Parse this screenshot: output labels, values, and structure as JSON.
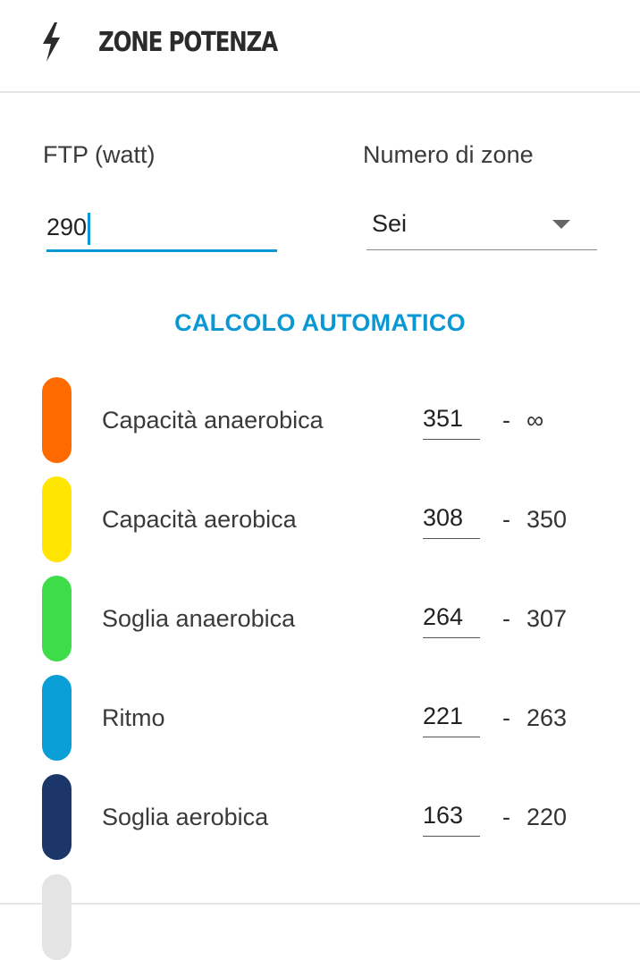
{
  "header": {
    "title": "ZONE POTENZA",
    "icon": "lightning-bolt-icon"
  },
  "form": {
    "ftp_label": "FTP (watt)",
    "ftp_value": "290",
    "zones_label": "Numero di zone",
    "zones_value": "Sei"
  },
  "auto_calc_label": "CALCOLO AUTOMATICO",
  "zones": [
    {
      "name": "Capacità anaerobica",
      "min": "351",
      "dash": "-",
      "max": "∞",
      "color": "#ff6a00"
    },
    {
      "name": "Capacità aerobica",
      "min": "308",
      "dash": "-",
      "max": "350",
      "color": "#ffe600"
    },
    {
      "name": "Soglia anaerobica",
      "min": "264",
      "dash": "-",
      "max": "307",
      "color": "#3ddc4a"
    },
    {
      "name": "Ritmo",
      "min": "221",
      "dash": "-",
      "max": "263",
      "color": "#0a9ed6"
    },
    {
      "name": "Soglia aerobica",
      "min": "163",
      "dash": "-",
      "max": "220",
      "color": "#1c3669"
    },
    {
      "name": "",
      "min": "",
      "dash": "",
      "max": "",
      "color": "#e4e4e4"
    }
  ],
  "colors": {
    "accent": "#0a98d4"
  }
}
